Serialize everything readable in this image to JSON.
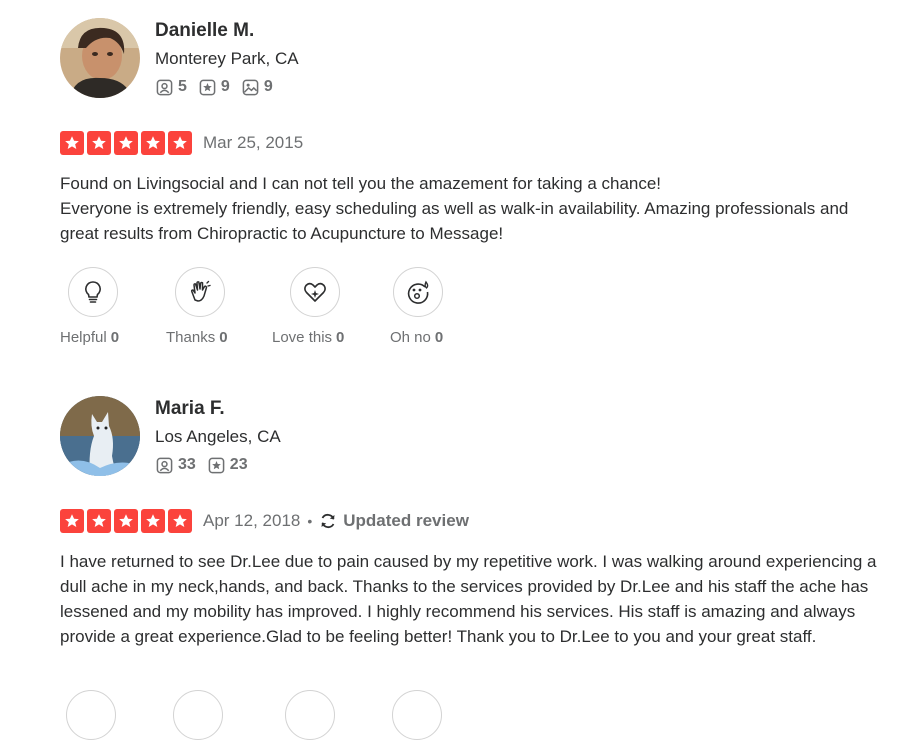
{
  "reviews": [
    {
      "name": "Danielle M.",
      "location": "Monterey Park, CA",
      "stats": {
        "friends": "5",
        "reviews": "9",
        "photos": "9"
      },
      "rating": 5,
      "date": "Mar 25, 2015",
      "text_lines": [
        "Found on Livingsocial and I can not tell you the amazement for taking a chance!",
        "Everyone is extremely friendly, easy scheduling as well as walk-in availability. Amazing professionals and great results from Chiropractic to Acupuncture to Message!"
      ],
      "reactions": [
        {
          "label": "Helpful",
          "count": "0",
          "icon": "lightbulb-icon"
        },
        {
          "label": "Thanks",
          "count": "0",
          "icon": "wave-hand-icon"
        },
        {
          "label": "Love this",
          "count": "0",
          "icon": "heart-sparkle-icon"
        },
        {
          "label": "Oh no",
          "count": "0",
          "icon": "surprised-face-icon"
        }
      ]
    },
    {
      "name": "Maria F.",
      "location": "Los Angeles, CA",
      "stats": {
        "friends": "33",
        "reviews": "23"
      },
      "rating": 5,
      "date": "Apr 12, 2018",
      "separator": "•",
      "updated_label": "Updated review",
      "text": "I have returned to see Dr.Lee due to pain caused by my repetitive work. I was walking around experiencing a dull ache in my neck,hands, and back. Thanks to the services provided by Dr.Lee and his staff the ache has lessened and my mobility has improved. I highly recommend his services. His staff is amazing and always provide a great experience.Glad to be feeling better! Thank you to Dr.Lee to you and your great staff."
    }
  ],
  "colors": {
    "star_red": "#fb433c",
    "muted_text": "#6e7072",
    "body_text": "#2d2e2f"
  }
}
